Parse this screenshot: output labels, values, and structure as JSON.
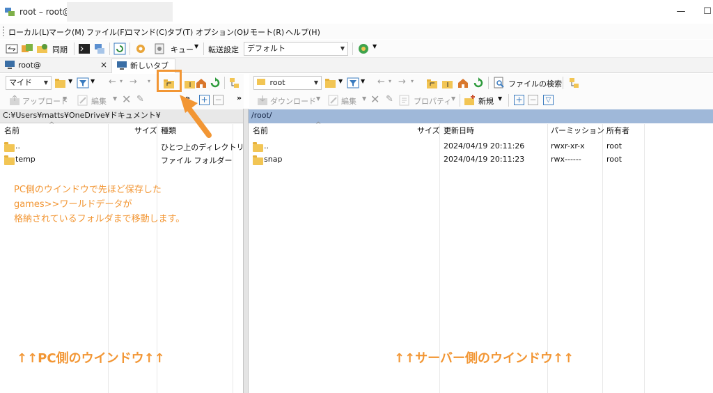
{
  "window": {
    "title": "root – root@",
    "minimize": "—",
    "maximize": "☐"
  },
  "menu": [
    "ローカル(L)",
    "マーク(M)",
    "ファイル(F)",
    "コマンド(C)",
    "タブ(T)",
    "オプション(O)",
    "リモート(R)",
    "ヘルプ(H)"
  ],
  "toolbar": {
    "sync_label": "同期",
    "queue_label": "キュー",
    "transfer_settings_label": "転送設定",
    "transfer_preset": "デフォルト"
  },
  "tabs": [
    {
      "label": "root@",
      "close": "×"
    },
    {
      "label": "新しいタブ",
      "arrow": "▾"
    }
  ],
  "left_pane": {
    "location": "マイド",
    "upload_label": "アップロード",
    "edit_label": "編集",
    "path": "C:¥Users¥matts¥OneDrive¥ドキュメント¥",
    "columns": {
      "name": "名前",
      "size": "サイズ",
      "type": "種類"
    },
    "rows": [
      {
        "name": "..",
        "type": "ひとつ上のディレクトリ"
      },
      {
        "name": "temp",
        "type": "ファイル フォルダー"
      }
    ]
  },
  "right_pane": {
    "location": "root",
    "find_files_label": "ファイルの検索",
    "download_label": "ダウンロード",
    "edit_label": "編集",
    "properties_label": "プロパティ",
    "new_label": "新規",
    "path": "/root/",
    "columns": {
      "name": "名前",
      "size": "サイズ",
      "modified": "更新日時",
      "permissions": "パーミッション",
      "owner": "所有者"
    },
    "rows": [
      {
        "name": "..",
        "modified": "2024/04/19 20:11:26",
        "permissions": "rwxr-xr-x",
        "owner": "root"
      },
      {
        "name": "snap",
        "modified": "2024/04/19 20:11:23",
        "permissions": "rwx------",
        "owner": "root"
      }
    ]
  },
  "annotations": {
    "instruction_line1": "PC側のウインドウで先ほど保存した",
    "instruction_line2": "games>>ワールドデータが",
    "instruction_line3": "格納されているフォルダまで移動します。",
    "pc_window_label": "↑↑PC側のウインドウ↑↑",
    "server_window_label": "↑↑サーバー側のウインドウ↑↑"
  },
  "colors": {
    "annotation": "#f29634",
    "remote_path_bar": "#9fb8d9",
    "folder": "#f2c554"
  }
}
